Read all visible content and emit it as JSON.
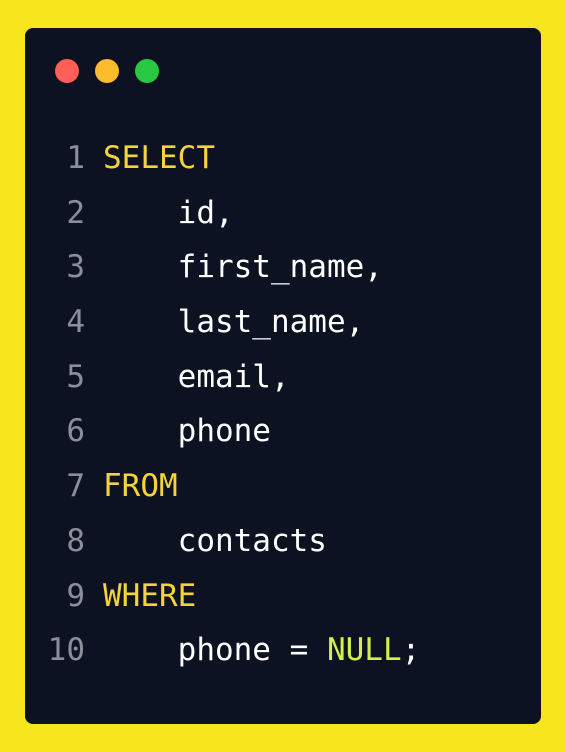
{
  "window": {
    "controls": [
      {
        "name": "close",
        "color": "#ff5f57"
      },
      {
        "name": "minimize",
        "color": "#fdbc2c"
      },
      {
        "name": "maximize",
        "color": "#28c840"
      }
    ]
  },
  "code": {
    "colors": {
      "keyword": "#f6d23d",
      "literal": "#d3f148",
      "text": "#ffffff",
      "line_number": "#8a8f99"
    },
    "lines": [
      {
        "number": "1",
        "tokens": [
          {
            "text": "SELECT",
            "kind": "kw"
          }
        ]
      },
      {
        "number": "2",
        "tokens": [
          {
            "text": "    id,",
            "kind": "plain"
          }
        ]
      },
      {
        "number": "3",
        "tokens": [
          {
            "text": "    first_name,",
            "kind": "plain"
          }
        ]
      },
      {
        "number": "4",
        "tokens": [
          {
            "text": "    last_name,",
            "kind": "plain"
          }
        ]
      },
      {
        "number": "5",
        "tokens": [
          {
            "text": "    email,",
            "kind": "plain"
          }
        ]
      },
      {
        "number": "6",
        "tokens": [
          {
            "text": "    phone",
            "kind": "plain"
          }
        ]
      },
      {
        "number": "7",
        "tokens": [
          {
            "text": "FROM",
            "kind": "kw"
          }
        ]
      },
      {
        "number": "8",
        "tokens": [
          {
            "text": "    contacts",
            "kind": "plain"
          }
        ]
      },
      {
        "number": "9",
        "tokens": [
          {
            "text": "WHERE",
            "kind": "kw"
          }
        ]
      },
      {
        "number": "10",
        "tokens": [
          {
            "text": "    phone = ",
            "kind": "plain"
          },
          {
            "text": "NULL",
            "kind": "lit"
          },
          {
            "text": ";",
            "kind": "plain"
          }
        ]
      }
    ]
  }
}
